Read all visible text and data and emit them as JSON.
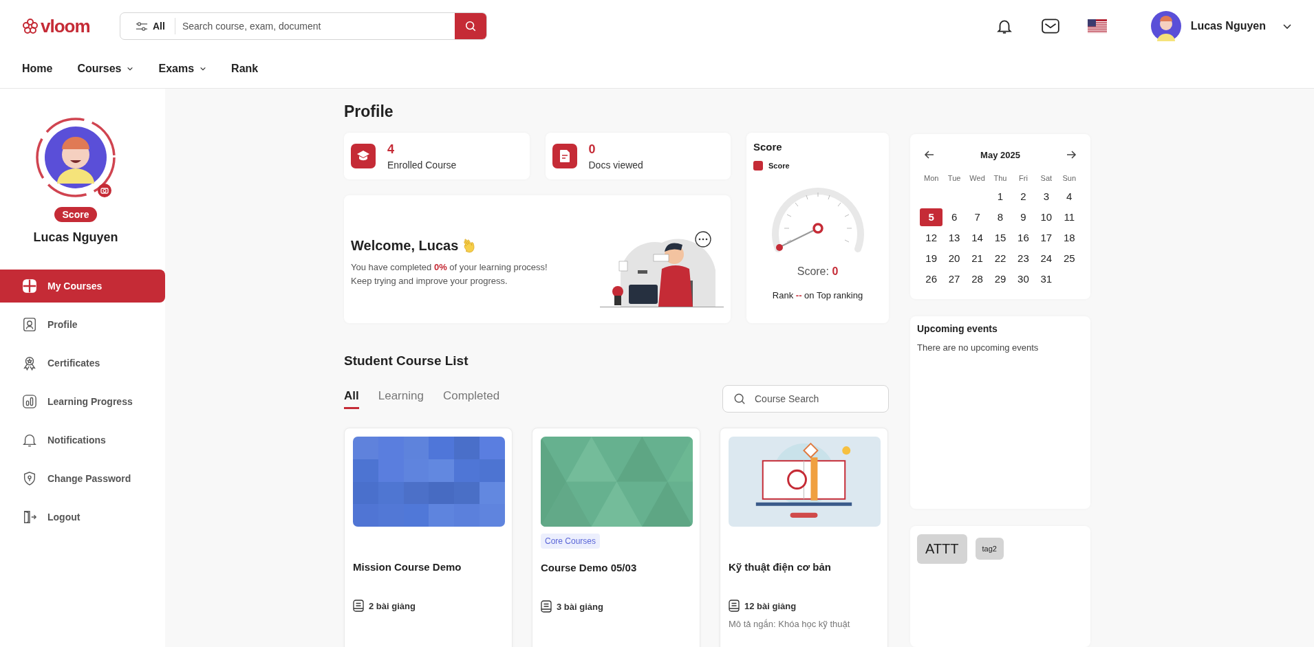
{
  "header": {
    "logo": "vloom",
    "search": {
      "filter_label": "All",
      "placeholder": "Search course, exam, document"
    },
    "user_name": "Lucas Nguyen"
  },
  "nav": [
    {
      "label": "Home",
      "has_menu": false
    },
    {
      "label": "Courses",
      "has_menu": true
    },
    {
      "label": "Exams",
      "has_menu": true
    },
    {
      "label": "Rank",
      "has_menu": false
    }
  ],
  "sidebar": {
    "badge": "Score",
    "name": "Lucas Nguyen",
    "items": [
      {
        "label": "My Courses",
        "selected": true
      },
      {
        "label": "Profile",
        "selected": false
      },
      {
        "label": "Certificates",
        "selected": false
      },
      {
        "label": "Learning Progress",
        "selected": false
      },
      {
        "label": "Notifications",
        "selected": false
      },
      {
        "label": "Change Password",
        "selected": false
      },
      {
        "label": "Logout",
        "selected": false
      }
    ]
  },
  "page_title": "Profile",
  "stats": [
    {
      "value": "4",
      "label": "Enrolled Course"
    },
    {
      "value": "0",
      "label": "Docs viewed"
    }
  ],
  "welcome": {
    "title": "Welcome, Lucas",
    "lines": [
      "You have completed **0%** of your learning process!",
      "Keep trying and improve your progress."
    ]
  },
  "score": {
    "title": "Score",
    "legend": "Score",
    "score_label": "Score:",
    "score_value": "0",
    "rank": "Rank **--** on Top ranking"
  },
  "calendar": {
    "month": "May 2025",
    "weekdays": [
      "Mon",
      "Tue",
      "Wed",
      "Thu",
      "Fri",
      "Sat",
      "Sun"
    ],
    "weeks": [
      [
        {
          "day": "1",
          "selected": false
        },
        {
          "day": "2",
          "selected": false
        },
        {
          "day": "3",
          "selected": false
        },
        {
          "day": "4",
          "selected": false
        }
      ],
      [
        {
          "day": "5",
          "selected": true
        },
        {
          "day": "6",
          "selected": false
        },
        {
          "day": "7",
          "selected": false
        },
        {
          "day": "8",
          "selected": false
        },
        {
          "day": "9",
          "selected": false
        },
        {
          "day": "10",
          "selected": false
        },
        {
          "day": "11",
          "selected": false
        }
      ],
      [
        {
          "day": "12",
          "selected": false
        },
        {
          "day": "13",
          "selected": false
        },
        {
          "day": "14",
          "selected": false
        },
        {
          "day": "15",
          "selected": false
        },
        {
          "day": "16",
          "selected": false
        },
        {
          "day": "17",
          "selected": false
        },
        {
          "day": "18",
          "selected": false
        }
      ],
      [
        {
          "day": "19",
          "selected": false
        },
        {
          "day": "20",
          "selected": false
        },
        {
          "day": "21",
          "selected": false
        },
        {
          "day": "22",
          "selected": false
        },
        {
          "day": "23",
          "selected": false
        },
        {
          "day": "24",
          "selected": false
        },
        {
          "day": "25",
          "selected": false
        }
      ],
      [
        {
          "day": "26",
          "selected": false
        },
        {
          "day": "27",
          "selected": false
        },
        {
          "day": "28",
          "selected": false
        },
        {
          "day": "29",
          "selected": false
        },
        {
          "day": "30",
          "selected": false
        },
        {
          "day": "31",
          "selected": false
        }
      ]
    ]
  },
  "events": {
    "title": "Upcoming events",
    "empty_text": "There are no upcoming events"
  },
  "tags": [
    {
      "label": "ATTT",
      "kind": "large"
    },
    {
      "label": "tag2",
      "kind": "small"
    }
  ],
  "course_list": {
    "title": "Student Course List",
    "tabs": [
      {
        "label": "All",
        "selected": true
      },
      {
        "label": "Learning",
        "selected": false
      },
      {
        "label": "Completed",
        "selected": false
      }
    ],
    "search_placeholder": "Course Search",
    "courses": [
      {
        "title": "Mission Course Demo",
        "lessons": "2 bài giảng"
      },
      {
        "title": "Course Demo 05/03",
        "lessons": "3 bài giảng",
        "tag": "Core Courses"
      },
      {
        "title": "Kỹ thuật điện cơ bản",
        "lessons": "12 bài giảng",
        "description": "Mô tả ngắn: Khóa học kỹ thuật"
      }
    ]
  }
}
